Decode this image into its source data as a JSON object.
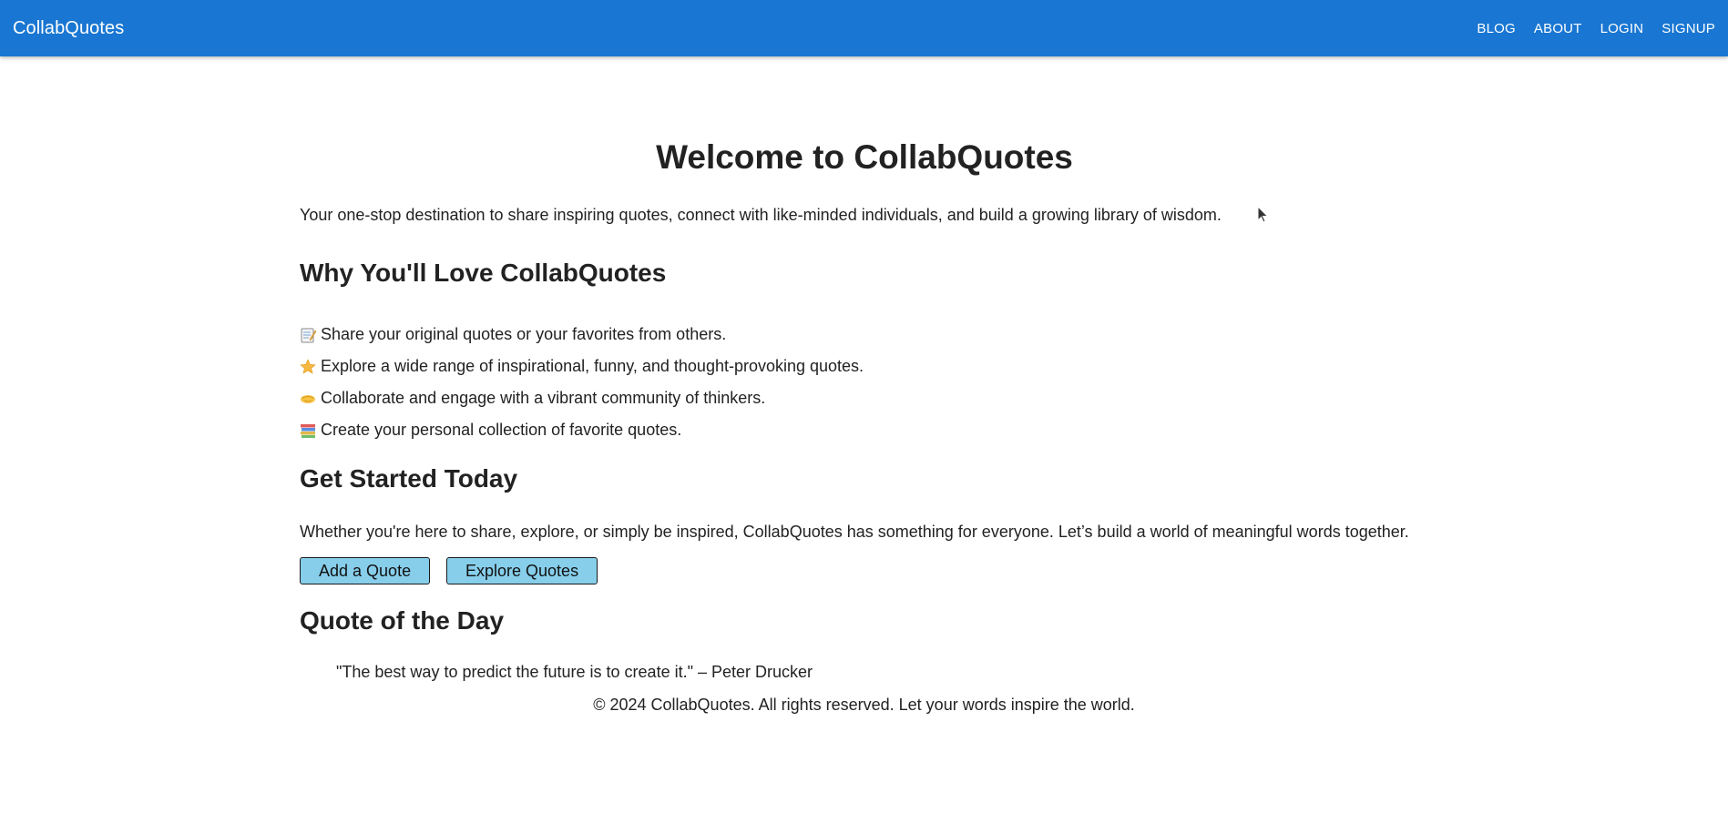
{
  "header": {
    "brand": "CollabQuotes",
    "nav": [
      "BLOG",
      "ABOUT",
      "LOGIN",
      "SIGNUP"
    ]
  },
  "hero": {
    "title": "Welcome to CollabQuotes",
    "tagline": "Your one-stop destination to share inspiring quotes, connect with like-minded individuals, and build a growing library of wisdom."
  },
  "why": {
    "heading": "Why You'll Love CollabQuotes",
    "items": [
      {
        "icon": "memo-icon",
        "text": "Share your original quotes or your favorites from others."
      },
      {
        "icon": "star-icon",
        "text": "Explore a wide range of inspirational, funny, and thought-provoking quotes."
      },
      {
        "icon": "handshake-icon",
        "text": "Collaborate and engage with a vibrant community of thinkers."
      },
      {
        "icon": "books-icon",
        "text": "Create your personal collection of favorite quotes."
      }
    ]
  },
  "get_started": {
    "heading": "Get Started Today",
    "text": "Whether you're here to share, explore, or simply be inspired, CollabQuotes has something for everyone. Let’s build a world of meaningful words together.",
    "add_button": "Add a Quote",
    "explore_button": "Explore Quotes"
  },
  "qotd": {
    "heading": "Quote of the Day",
    "quote": "\"The best way to predict the future is to create it.\" – Peter Drucker"
  },
  "footer": {
    "text": "© 2024 CollabQuotes. All rights reserved. Let your words inspire the world."
  },
  "colors": {
    "appbar": "#1976d2",
    "button": "#87ceeb",
    "text": "#222222"
  }
}
